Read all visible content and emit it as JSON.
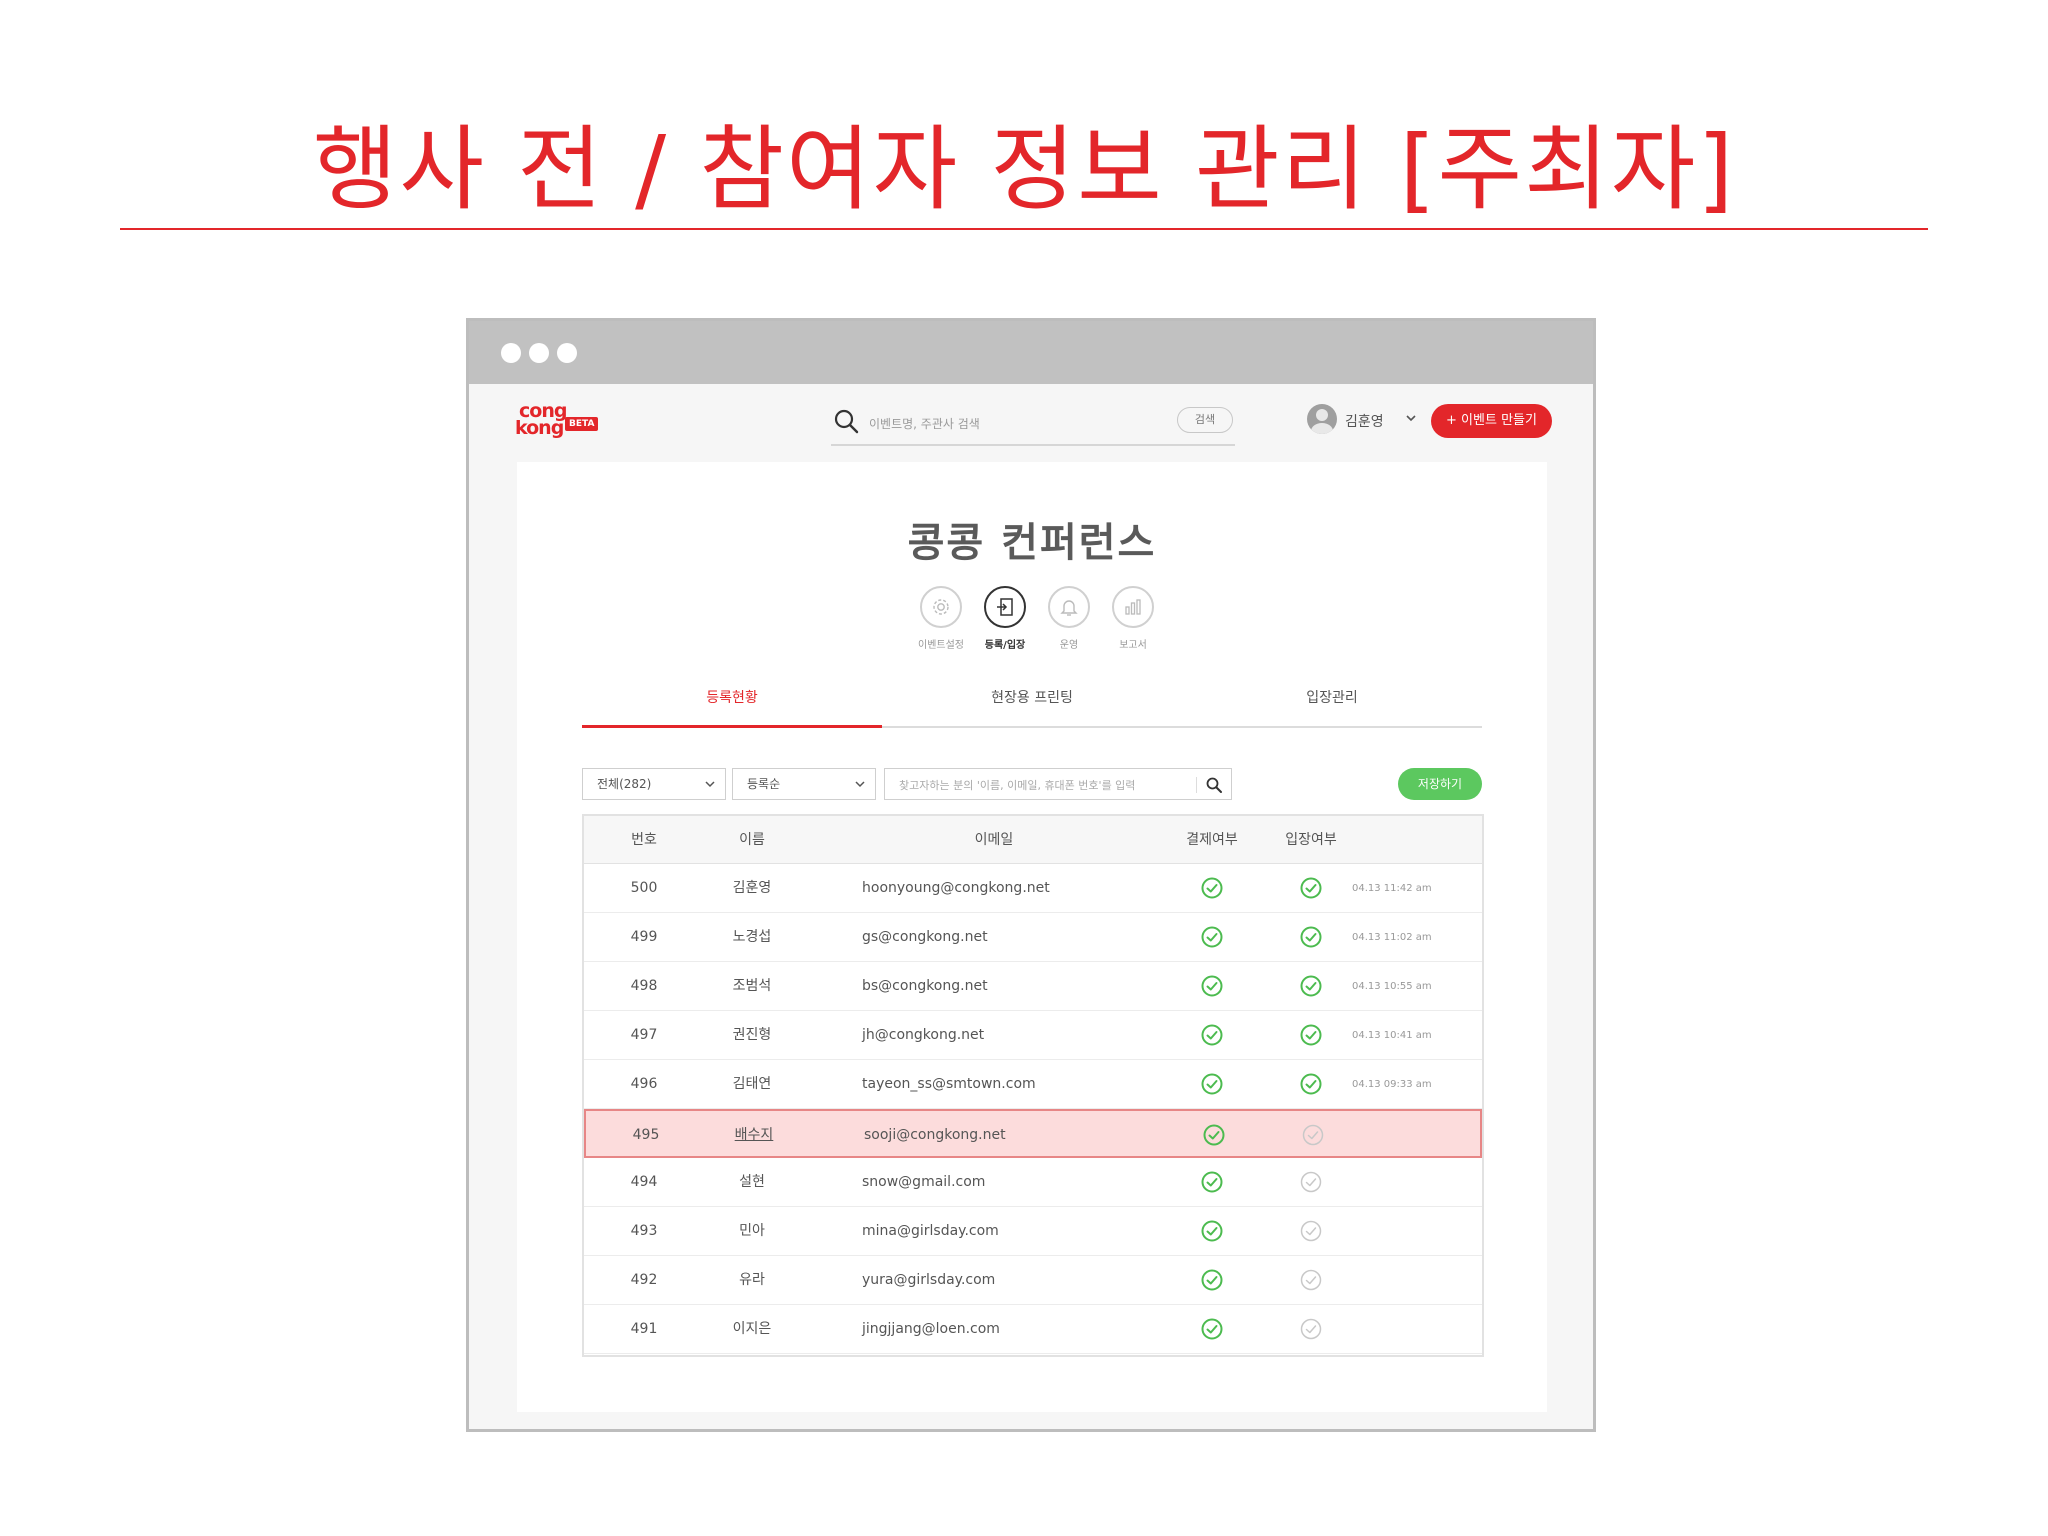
{
  "slide": {
    "title": "행사 전 / 참여자 정보 관리 [주최자]"
  },
  "colors": {
    "brand_red": "#e3262a",
    "save_green": "#5cc85f",
    "check_green": "#4cbb4f",
    "check_grey": "#c8c8c8",
    "highlight_bg": "#fcdcdc"
  },
  "header": {
    "logo_line1": "cong",
    "logo_line2": "kong",
    "logo_badge": "BETA",
    "search_placeholder": "이벤트명, 주관사 검색",
    "search_button": "검색",
    "user_name": "김훈영",
    "create_button": "+ 이벤트 만들기"
  },
  "event": {
    "title": "콩콩 컨퍼런스",
    "steps": [
      {
        "label": "이벤트설정",
        "icon": "gear-icon",
        "active": false
      },
      {
        "label": "등록/입장",
        "icon": "login-icon",
        "active": true
      },
      {
        "label": "운영",
        "icon": "bell-icon",
        "active": false
      },
      {
        "label": "보고서",
        "icon": "chart-icon",
        "active": false
      }
    ]
  },
  "tabs": [
    {
      "label": "등록현황",
      "active": true
    },
    {
      "label": "현장용 프린팅",
      "active": false
    },
    {
      "label": "입장관리",
      "active": false
    }
  ],
  "filters": {
    "scope_select": "전체(282)",
    "sort_select": "등록순",
    "search_placeholder": "찾고자하는 분의 '이름, 이메일, 휴대폰 번호'를 입력",
    "save_button": "저장하기"
  },
  "table": {
    "headers": {
      "num": "번호",
      "name": "이름",
      "email": "이메일",
      "pay": "결제여부",
      "entry": "입장여부"
    },
    "rows": [
      {
        "num": "500",
        "name": "김훈영",
        "email": "hoonyoung@congkong.net",
        "paid": true,
        "entered": true,
        "time": "04.13 11:42 am"
      },
      {
        "num": "499",
        "name": "노경섭",
        "email": "gs@congkong.net",
        "paid": true,
        "entered": true,
        "time": "04.13 11:02 am"
      },
      {
        "num": "498",
        "name": "조범석",
        "email": "bs@congkong.net",
        "paid": true,
        "entered": true,
        "time": "04.13 10:55 am"
      },
      {
        "num": "497",
        "name": "권진형",
        "email": "jh@congkong.net",
        "paid": true,
        "entered": true,
        "time": "04.13 10:41 am"
      },
      {
        "num": "496",
        "name": "김태연",
        "email": "tayeon_ss@smtown.com",
        "paid": true,
        "entered": true,
        "time": "04.13 09:33 am"
      },
      {
        "num": "495",
        "name": "배수지",
        "email": "sooji@congkong.net",
        "paid": true,
        "entered": false,
        "time": "",
        "highlighted": true
      },
      {
        "num": "494",
        "name": "설현",
        "email": "snow@gmail.com",
        "paid": true,
        "entered": false,
        "time": ""
      },
      {
        "num": "493",
        "name": "민아",
        "email": "mina@girlsday.com",
        "paid": true,
        "entered": false,
        "time": ""
      },
      {
        "num": "492",
        "name": "유라",
        "email": "yura@girlsday.com",
        "paid": true,
        "entered": false,
        "time": ""
      },
      {
        "num": "491",
        "name": "이지은",
        "email": "jingjjang@loen.com",
        "paid": true,
        "entered": false,
        "time": ""
      }
    ]
  }
}
